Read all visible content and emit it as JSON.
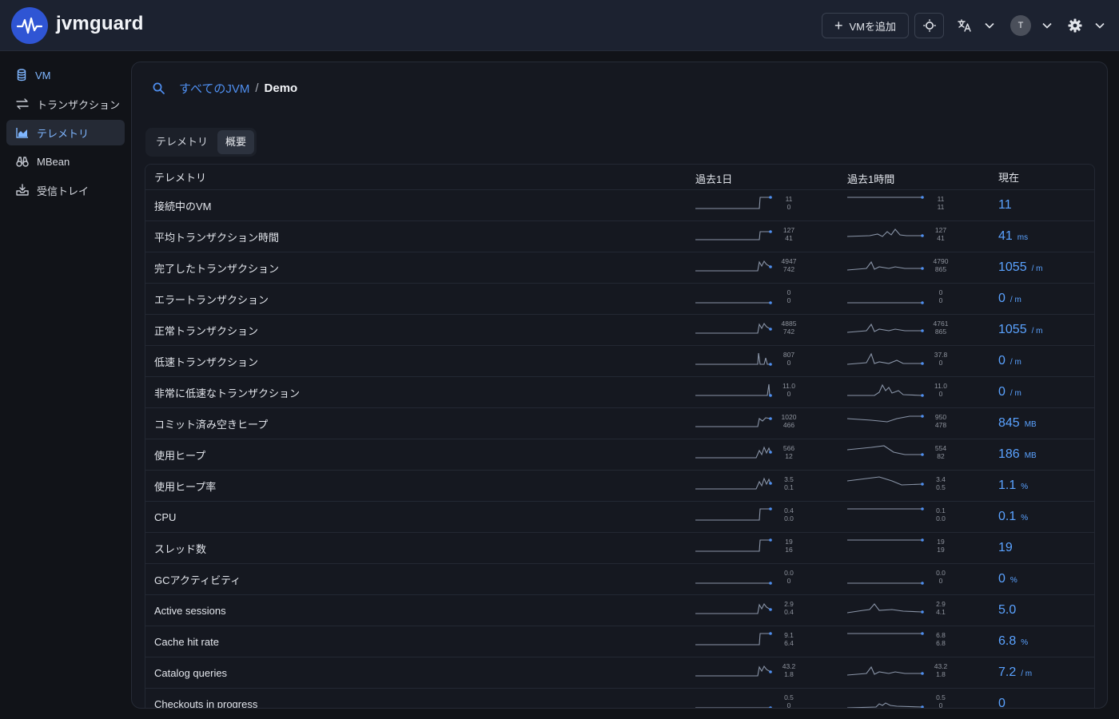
{
  "app": {
    "name": "jvmguard"
  },
  "header": {
    "add_vm_label": "VMを追加",
    "user_initial": "T"
  },
  "sidebar": {
    "items": [
      {
        "label": "VM",
        "icon": "database-icon"
      },
      {
        "label": "トランザクション",
        "icon": "transaction-icon"
      },
      {
        "label": "テレメトリ",
        "icon": "chart-area-icon",
        "active": true
      },
      {
        "label": "MBean",
        "icon": "binoculars-icon"
      },
      {
        "label": "受信トレイ",
        "icon": "inbox-icon"
      }
    ]
  },
  "breadcrumb": {
    "link": "すべてのJVM",
    "separator": "/",
    "current": "Demo"
  },
  "tabs": [
    {
      "label": "テレメトリ",
      "active": false
    },
    {
      "label": "概要",
      "active": true
    }
  ],
  "table": {
    "headers": [
      "テレメトリ",
      "過去1日",
      "過去1時間",
      "現在"
    ],
    "rows": [
      {
        "name": "接続中のVM",
        "day": {
          "max": "11",
          "min": "0",
          "shape": "step"
        },
        "hour": {
          "max": "11",
          "min": "11",
          "shape": "flat-high"
        },
        "value": "11",
        "unit": ""
      },
      {
        "name": "平均トランザクション時間",
        "day": {
          "max": "127",
          "min": "41",
          "shape": "step-late"
        },
        "hour": {
          "max": "127",
          "min": "41",
          "shape": "bumpy"
        },
        "value": "41",
        "unit": "ms"
      },
      {
        "name": "完了したトランザクション",
        "day": {
          "max": "4947",
          "min": "742",
          "shape": "step-spike"
        },
        "hour": {
          "max": "4790",
          "min": "865",
          "shape": "spike-early"
        },
        "value": "1055",
        "unit": "/ m"
      },
      {
        "name": "エラートランザクション",
        "day": {
          "max": "0",
          "min": "0",
          "shape": "flat-low"
        },
        "hour": {
          "max": "0",
          "min": "0",
          "shape": "flat-low"
        },
        "value": "0",
        "unit": "/ m"
      },
      {
        "name": "正常トランザクション",
        "day": {
          "max": "4885",
          "min": "742",
          "shape": "step-spike"
        },
        "hour": {
          "max": "4761",
          "min": "865",
          "shape": "spike-early"
        },
        "value": "1055",
        "unit": "/ m"
      },
      {
        "name": "低速トランザクション",
        "day": {
          "max": "807",
          "min": "0",
          "shape": "late-spike"
        },
        "hour": {
          "max": "37.8",
          "min": "0",
          "shape": "spike-early2"
        },
        "value": "0",
        "unit": "/ m"
      },
      {
        "name": "非常に低速なトランザクション",
        "day": {
          "max": "11.0",
          "min": "0",
          "shape": "single-spike"
        },
        "hour": {
          "max": "11.0",
          "min": "0",
          "shape": "mid-spikes"
        },
        "value": "0",
        "unit": "/ m"
      },
      {
        "name": "コミット済み空きヒープ",
        "day": {
          "max": "1020",
          "min": "466",
          "shape": "step-wave"
        },
        "hour": {
          "max": "950",
          "min": "478",
          "shape": "rise"
        },
        "value": "845",
        "unit": "MB"
      },
      {
        "name": "使用ヒープ",
        "day": {
          "max": "566",
          "min": "12",
          "shape": "zigzag-late"
        },
        "hour": {
          "max": "554",
          "min": "82",
          "shape": "fall"
        },
        "value": "186",
        "unit": "MB"
      },
      {
        "name": "使用ヒープ率",
        "day": {
          "max": "3.5",
          "min": "0.1",
          "shape": "zigzag-late"
        },
        "hour": {
          "max": "3.4",
          "min": "0.5",
          "shape": "fall2"
        },
        "value": "1.1",
        "unit": "%"
      },
      {
        "name": "CPU",
        "day": {
          "max": "0.4",
          "min": "0.0",
          "shape": "step"
        },
        "hour": {
          "max": "0.1",
          "min": "0.0",
          "shape": "flat-high"
        },
        "value": "0.1",
        "unit": "%"
      },
      {
        "name": "スレッド数",
        "day": {
          "max": "19",
          "min": "16",
          "shape": "step"
        },
        "hour": {
          "max": "19",
          "min": "19",
          "shape": "flat-high"
        },
        "value": "19",
        "unit": ""
      },
      {
        "name": "GCアクティビティ",
        "day": {
          "max": "0.0",
          "min": "0",
          "shape": "flat-low"
        },
        "hour": {
          "max": "0.0",
          "min": "0",
          "shape": "flat-low"
        },
        "value": "0",
        "unit": "%"
      },
      {
        "name": "Active sessions",
        "day": {
          "max": "2.9",
          "min": "0.4",
          "shape": "step-spike"
        },
        "hour": {
          "max": "2.9",
          "min": "4.1",
          "shape": "bumpy2"
        },
        "value": "5.0",
        "unit": ""
      },
      {
        "name": "Cache hit rate",
        "day": {
          "max": "9.1",
          "min": "6.4",
          "shape": "step"
        },
        "hour": {
          "max": "6.8",
          "min": "6.8",
          "shape": "flat-high"
        },
        "value": "6.8",
        "unit": "%"
      },
      {
        "name": "Catalog queries",
        "day": {
          "max": "43.2",
          "min": "1.8",
          "shape": "step-spike"
        },
        "hour": {
          "max": "43.2",
          "min": "1.8",
          "shape": "spike-early"
        },
        "value": "7.2",
        "unit": "/ m"
      },
      {
        "name": "Checkouts in progress",
        "day": {
          "max": "0.5",
          "min": "0",
          "shape": "flat-low"
        },
        "hour": {
          "max": "0.5",
          "min": "0",
          "shape": "mid-bump"
        },
        "value": "0",
        "unit": ""
      }
    ]
  },
  "colors": {
    "accent": "#5aa2ff",
    "link": "#4f8ff0",
    "spark_line": "#8a95a8",
    "spark_dot": "#4f8ff0",
    "brand": "#2f55d4"
  }
}
